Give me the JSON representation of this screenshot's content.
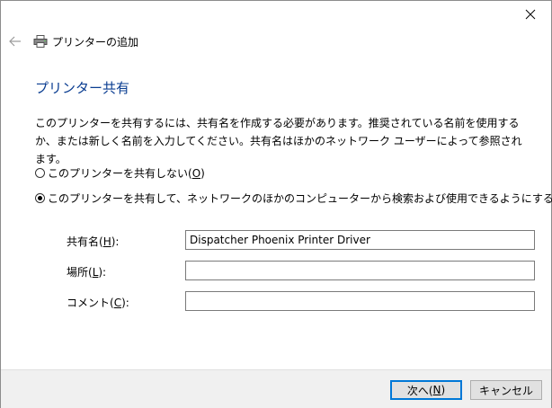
{
  "window": {
    "title": "プリンターの追加"
  },
  "page": {
    "heading": "プリンター共有",
    "description": "このプリンターを共有するには、共有名を作成する必要があります。推奨されている名前を使用するか、または新しく名前を入力してください。共有名はほかのネットワーク ユーザーによって参照されます。"
  },
  "sharing_options": [
    {
      "label": "このプリンターを共有しない(",
      "key": "O",
      "suffix": ")",
      "selected": false
    },
    {
      "label": "このプリンターを共有して、ネットワークのほかのコンピューターから検索および使用できるようにする(",
      "key": "S",
      "suffix": ")",
      "selected": true
    }
  ],
  "fields": {
    "share_name": {
      "label": "共有名(",
      "key": "H",
      "suffix": "):",
      "value": "Dispatcher Phoenix Printer Driver"
    },
    "location": {
      "label": "場所(",
      "key": "L",
      "suffix": "):",
      "value": ""
    },
    "comment": {
      "label": "コメント(",
      "key": "C",
      "suffix": "):",
      "value": ""
    }
  },
  "buttons": {
    "next": {
      "label": "次へ(",
      "key": "N",
      "suffix": ")"
    },
    "cancel": "キャンセル"
  },
  "colors": {
    "heading": "#0a3d91",
    "primary_button_border": "#0078d7",
    "footer_background": "#f0f0f0"
  },
  "icons": {
    "close": "close-icon",
    "back": "back-arrow-icon",
    "printer": "printer-icon"
  }
}
